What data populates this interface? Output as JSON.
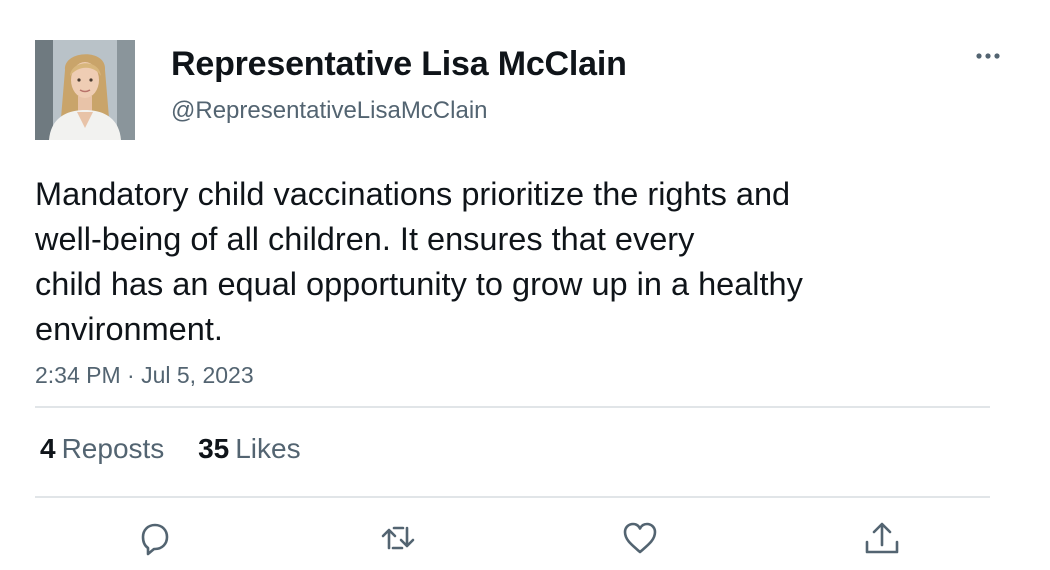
{
  "author": {
    "display_name": "Representative Lisa McClain",
    "handle": "@RepresentativeLisaMcClain"
  },
  "tweet": {
    "text_lines": [
      "Mandatory child vaccinations prioritize the rights and",
      "well-being of all children. It ensures that every",
      "child has an equal opportunity to grow up in a healthy",
      "environment."
    ],
    "timestamp": "2:34 PM · Jul 5, 2023"
  },
  "stats": {
    "reposts_count": "4",
    "reposts_label": "Reposts",
    "likes_count": "35",
    "likes_label": "Likes"
  },
  "actions": [
    "reply-icon",
    "repost-icon",
    "like-icon",
    "share-icon"
  ],
  "colors": {
    "text": "#0f1419",
    "secondary": "#536471",
    "divider": "#e1e5e8"
  }
}
